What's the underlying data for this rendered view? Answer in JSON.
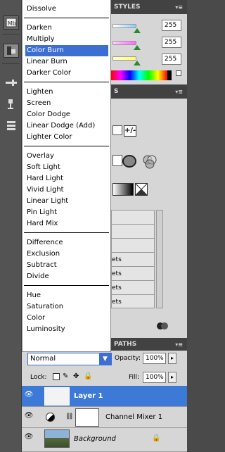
{
  "blend_modes": {
    "groups": [
      [
        "Dissolve"
      ],
      [
        "Darken",
        "Multiply",
        "Color Burn",
        "Linear Burn",
        "Darker Color"
      ],
      [
        "Lighten",
        "Screen",
        "Color Dodge",
        "Linear Dodge (Add)",
        "Lighter Color"
      ],
      [
        "Overlay",
        "Soft Light",
        "Hard Light",
        "Vivid Light",
        "Linear Light",
        "Pin Light",
        "Hard Mix"
      ],
      [
        "Difference",
        "Exclusion",
        "Subtract",
        "Divide"
      ],
      [
        "Hue",
        "Saturation",
        "Color",
        "Luminosity"
      ]
    ],
    "selected": "Color Burn",
    "current_value": "Normal"
  },
  "styles_panel": {
    "tab_label": "STYLES",
    "values": [
      "255",
      "255",
      "255"
    ]
  },
  "adjustments_panel": {
    "tab_label": "S",
    "row_labels": [
      "",
      "",
      "",
      "ets",
      "ets",
      "ets",
      "ets"
    ]
  },
  "layers_panel": {
    "tab_label": "PATHS",
    "opacity_label": "Opacity:",
    "opacity_value": "100%",
    "fill_label": "Fill:",
    "fill_value": "100%",
    "lock_label": "Lock:",
    "layers": [
      {
        "name": "Layer 1",
        "selected": true
      },
      {
        "name": "Channel Mixer 1",
        "selected": false
      },
      {
        "name": "Background",
        "selected": false
      }
    ]
  },
  "toolbar": {
    "icons": [
      "mini-bridge-icon",
      "history-icon",
      "adjustment-brush-icon",
      "clone-source-icon",
      "layer-comps-icon"
    ]
  },
  "colors": {
    "selection": "#3c6fd1",
    "layer_selected": "#3d7ad8"
  }
}
